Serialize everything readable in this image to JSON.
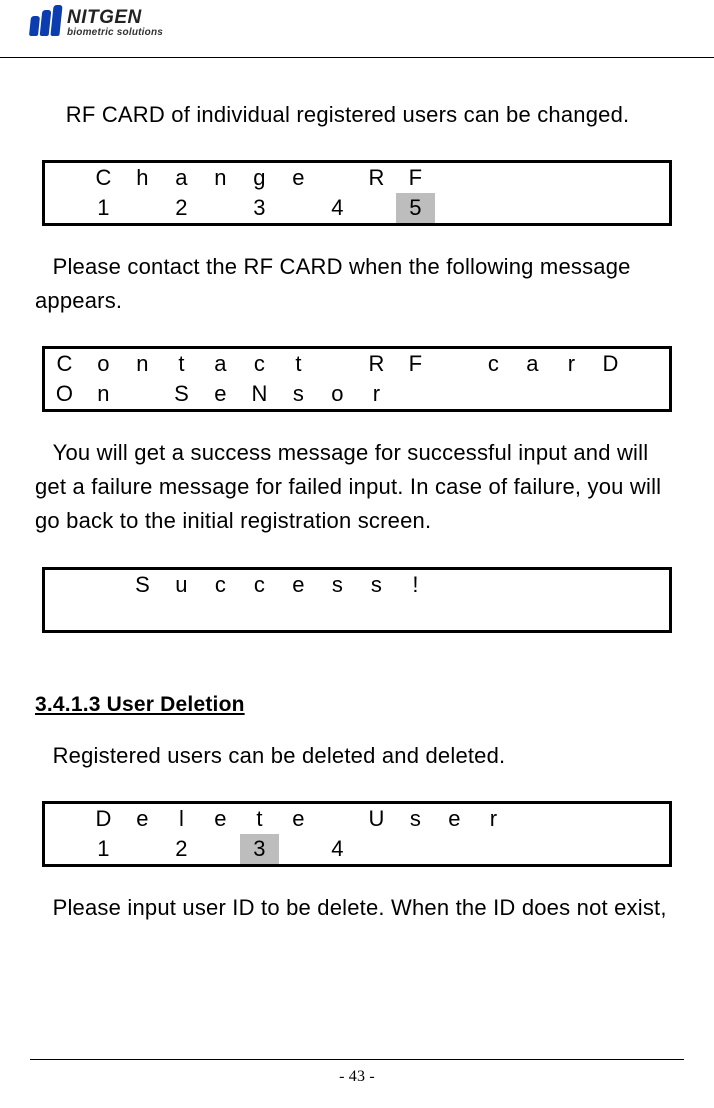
{
  "logo": {
    "title": "NITGEN",
    "subtitle": "biometric solutions"
  },
  "para1": "RF CARD of individual registered users can be changed.",
  "lcd1": {
    "row1": [
      "",
      "C",
      "h",
      "a",
      "n",
      "g",
      "e",
      "",
      "R",
      "F",
      "",
      "",
      "",
      "",
      "",
      ""
    ],
    "row2": [
      "",
      "1",
      "",
      "2",
      "",
      "3",
      "",
      "4",
      "",
      "5",
      "",
      "",
      "",
      "",
      "",
      ""
    ],
    "highlight_row2_index": 9
  },
  "para2": "Please contact the RF CARD when the following message appears.",
  "lcd2": {
    "row1": [
      "C",
      "o",
      "n",
      "t",
      "a",
      "c",
      "t",
      "",
      "R",
      "F",
      "",
      "c",
      "a",
      "r",
      "D",
      ""
    ],
    "row2": [
      "O",
      "n",
      "",
      "S",
      "e",
      "N",
      "s",
      "o",
      "r",
      "",
      "",
      "",
      "",
      "",
      "",
      ""
    ]
  },
  "para3": "You will get a success message for successful input and will get a failure message for failed input. In case of failure, you will go back to the initial registration screen.",
  "lcd3": {
    "row1": [
      "",
      "",
      "S",
      "u",
      "c",
      "c",
      "e",
      "s",
      "s",
      "!",
      "",
      "",
      "",
      "",
      "",
      ""
    ],
    "row2": [
      "",
      "",
      "",
      "",
      "",
      "",
      "",
      "",
      "",
      "",
      "",
      "",
      "",
      "",
      "",
      ""
    ]
  },
  "section_heading": "3.4.1.3 User Deletion",
  "para4": "Registered users can be deleted and deleted.",
  "lcd4": {
    "row1": [
      "",
      "D",
      "e",
      "l",
      "e",
      "t",
      "e",
      "",
      "U",
      "s",
      "e",
      "r",
      "",
      "",
      "",
      ""
    ],
    "row2": [
      "",
      "1",
      "",
      "2",
      "",
      "3",
      "",
      "4",
      "",
      "",
      "",
      "",
      "",
      "",
      "",
      ""
    ],
    "highlight_row2_index": 5
  },
  "para5": "Please input user ID to be delete. When the ID does not exist,",
  "page_number": "- 43 -"
}
